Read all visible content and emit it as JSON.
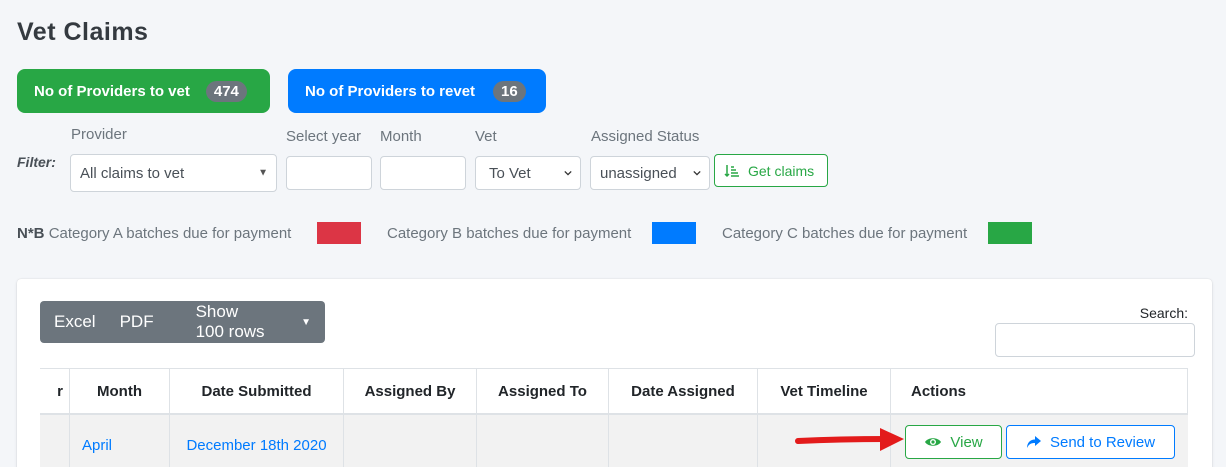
{
  "page": {
    "title": "Vet Claims"
  },
  "stats": {
    "to_vet": {
      "label": "No of Providers to vet",
      "count": "474"
    },
    "to_revet": {
      "label": "No of Providers to revet",
      "count": "16"
    }
  },
  "filter": {
    "label": "Filter:",
    "provider": {
      "label": "Provider",
      "value": "All claims to vet"
    },
    "year": {
      "label": "Select year",
      "value": ""
    },
    "month": {
      "label": "Month",
      "value": ""
    },
    "vet": {
      "label": "Vet",
      "value": "To Vet"
    },
    "assigned_status": {
      "label": "Assigned Status",
      "value": "unassigned"
    },
    "get_claims_label": "Get claims"
  },
  "legend": {
    "prefix": "N*B",
    "items": [
      {
        "label": "Category A batches due for payment",
        "color": "#dc3545"
      },
      {
        "label": "Category B batches due for payment",
        "color": "#007bff"
      },
      {
        "label": "Category C batches due for payment",
        "color": "#28a745"
      }
    ]
  },
  "table_tools": {
    "excel": "Excel",
    "pdf": "PDF",
    "show_rows": "Show 100 rows",
    "search_label": "Search:",
    "search_value": ""
  },
  "table": {
    "columns": [
      "r",
      "Month",
      "Date Submitted",
      "Assigned By",
      "Assigned To",
      "Date Assigned",
      "Vet Timeline",
      "Actions"
    ],
    "rows": [
      {
        "first": "",
        "month": "April",
        "date_submitted": "December 18th 2020",
        "assigned_by": "",
        "assigned_to": "",
        "date_assigned": "",
        "vet_timeline": ""
      }
    ],
    "actions": {
      "view": "View",
      "send_to_review": "Send to Review"
    }
  }
}
